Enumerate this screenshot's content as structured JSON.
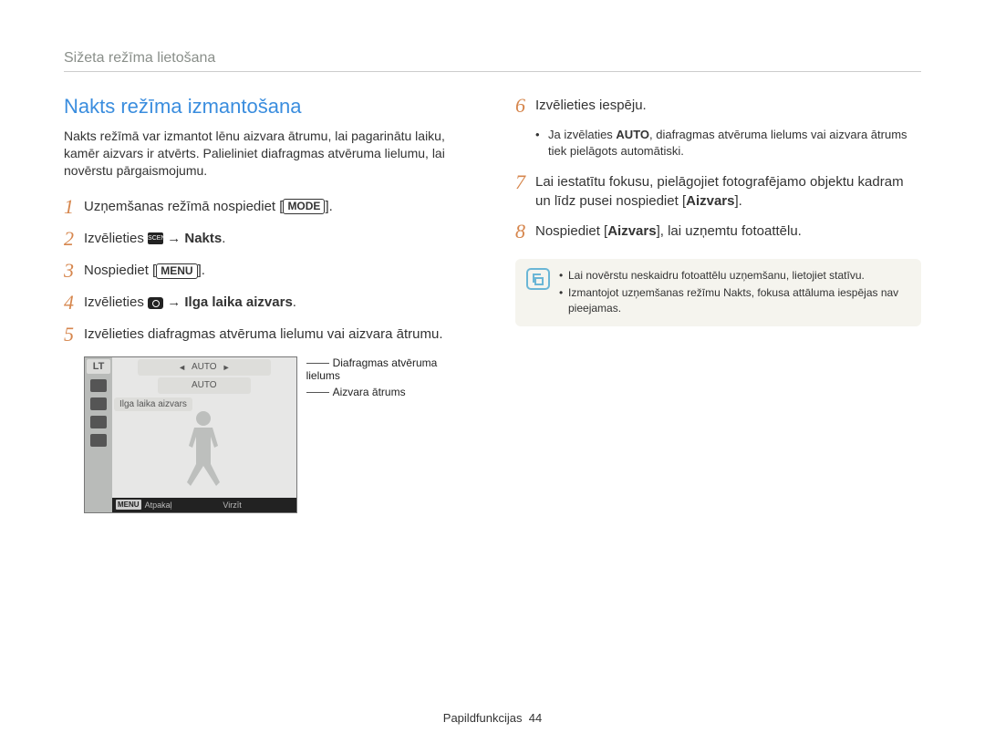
{
  "section_title": "Sižeta režīma lietošana",
  "heading": "Nakts režīma izmantošana",
  "intro": "Nakts režīmā var izmantot lēnu aizvara ātrumu, lai pagarinātu laiku, kamēr aizvars ir atvērts. Palieliniet diafragmas atvēruma lielumu, lai novērstu pārgaismojumu.",
  "steps_left": {
    "s1_pre": "Uzņemšanas režīmā nospiediet [",
    "s1_btn": "MODE",
    "s1_post": "].",
    "s2_pre": "Izvēlieties ",
    "s2_post_arrow": " → ",
    "s2_bold": "Nakts",
    "s2_end": ".",
    "s3_pre": "Nospiediet [",
    "s3_btn": "MENU",
    "s3_post": "].",
    "s4_pre": "Izvēlieties ",
    "s4_post_arrow": " → ",
    "s4_bold": "Ilga laika aizvars",
    "s4_end": ".",
    "s5": "Izvēlieties diafragmas atvēruma lielumu vai aizvara ātrumu."
  },
  "steps_right": {
    "s6": "Izvēlieties iespēju.",
    "s6_sub_pre": "Ja izvēlaties ",
    "s6_sub_bold": "AUTO",
    "s6_sub_post": ", diafragmas atvēruma lielums vai aizvara ātrums tiek pielāgots automātiski.",
    "s7_pre": "Lai iestatītu fokusu, pielāgojiet fotografējamo objektu kadram un līdz pusei nospiediet [",
    "s7_bold": "Aizvars",
    "s7_post": "].",
    "s8_pre": "Nospiediet [",
    "s8_bold": "Aizvars",
    "s8_post": "], lai uzņemtu fotoattēlu."
  },
  "note": {
    "item1": "Lai novērstu neskaidru fotoattēlu uzņemšanu, lietojiet statīvu.",
    "item2": "Izmantojot uzņemšanas režīmu Nakts, fokusa attāluma iespējas nav pieejamas."
  },
  "screen": {
    "lt": "LT",
    "auto1": "AUTO",
    "auto2": "AUTO",
    "row_label": "Ilga laika aizvars",
    "menu": "MENU",
    "back": "Atpakaļ",
    "move": "Virzīt"
  },
  "callouts": {
    "c1": "Diafragmas atvēruma lielums",
    "c2": "Aizvara ātrums"
  },
  "footer_label": "Papildfunkcijas",
  "footer_page": "44"
}
